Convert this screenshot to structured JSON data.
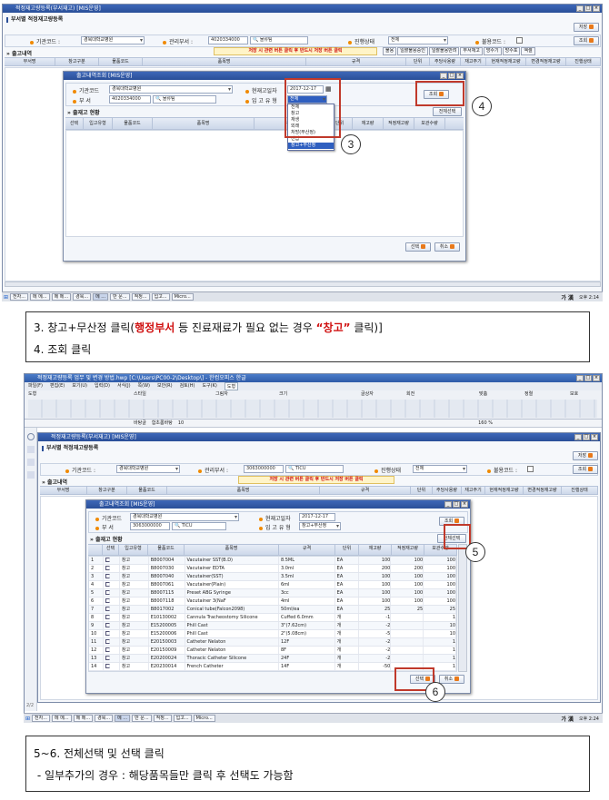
{
  "panel1": {
    "app_title": "적정재고량등록(부서재고) [MIS운영]",
    "page_title": "부서별 적정재고량등록",
    "save_btn": "저장",
    "org_label": "기관코드 :",
    "org_value": "경북대학교병원",
    "dept_label": "관리부서 :",
    "dept_code": "4020334000",
    "dept_name": "물류팀",
    "status_label": "진행상태",
    "status_value": "전체",
    "hold_label": "불용코드 :",
    "search_btn": "조회",
    "section_title": "출고내역",
    "warning_text": "저장 시 관련 버튼 클릭 후 반드시 저장 버튼 클릭",
    "action_buttons": [
      "불용",
      "일괄불용승인",
      "일괄불용반려",
      "부서재고",
      "방수기",
      "방수포",
      "엑셀"
    ],
    "grid_headers": [
      "부서명",
      "창고구분",
      "물품코드",
      "품목명",
      "규격",
      "단위",
      "주당사용량",
      "재고주기",
      "현재적정재고량",
      "변경적정재고량",
      "진행상태"
    ],
    "dialog": {
      "title": "출고내역조회 [MIS운영]",
      "org_label": "기관코드",
      "org_value": "경북대학교병원",
      "dept_label": "부   서",
      "dept_code": "4020334000",
      "dept_name": "물류팀",
      "date_label": "현재고일자",
      "date_value": "2017-12-17",
      "type_label": "입 고 유 형",
      "type_value": "전체",
      "search_btn": "조회",
      "section_title": "출재고 현황",
      "select_all": "전체선택",
      "headers": [
        "선택",
        "입고유형",
        "물품코드",
        "품목명",
        "규격",
        "단위",
        "재고량",
        "적정재고량",
        "보관수량"
      ],
      "dropdown": [
        "전체",
        "창고",
        "재생",
        "외래",
        "처방(무산정)",
        "선납",
        "창고+무산정"
      ],
      "select_btn": "선택",
      "cancel_btn": "취소"
    },
    "taskbar": [
      "전자...",
      "메 메...",
      "메 메...",
      "경북...",
      "메 ...",
      "반 문...",
      "적정...",
      "입고...",
      "Micro..."
    ],
    "tray_text": "가 漢",
    "clock": "오후 2:14",
    "marker3": "3",
    "marker4": "4"
  },
  "caption1": {
    "line1_pre": "3. 창고+무산정 클릭(",
    "line1_red": "행정부서",
    "line1_mid": " 등 진료재료가 필요 없는 경우 ",
    "line1_quote": "“창고”",
    "line1_post": " 클릭)]",
    "line2": "4. 조회 클릭"
  },
  "panel2": {
    "doc_title": "적정재고량등록 업무 및 변경 방법.hwp [C:\\Users\\PC00-2\\Desktop\\] - 한컴오피스 한글",
    "menus": [
      "파일(F)",
      "편집(E)",
      "보기(U)",
      "입력(D)",
      "서식(J)",
      "쪽(W)",
      "보안(R)",
      "검토(H)",
      "도구(K)",
      "도형"
    ],
    "ribbon_groups": [
      "도형",
      "스타일",
      "그림자",
      "크기",
      "글상자",
      "회전",
      "맞춤",
      "정렬",
      "보호"
    ],
    "toolbar_style": "바탕글",
    "toolbar_font": "함초롬바탕",
    "toolbar_size": "10",
    "zoom": "160 %",
    "app_title": "적정재고량등록(부서재고) [MIS운영]",
    "page_title": "부서별 적정재고량등록",
    "save_btn": "저장",
    "org_value": "경북대학교병원",
    "dept_code": "3063000000",
    "dept_name": "TICU",
    "status_value": "전체",
    "search_btn": "조회",
    "dialog": {
      "title": "출고내역조회 [MIS운영]",
      "org_value": "경북대학교병원",
      "dept_code": "3063000000",
      "dept_name": "TICU",
      "date_value": "2017-12-17",
      "type_value": "창고+무산정",
      "section_title": "출재고 현황",
      "select_all": "전체선택",
      "rows": [
        [
          "1",
          "창고",
          "B8007004",
          "Vacutainer SST(B.D)",
          "8.5ML",
          "EA",
          "100",
          "100",
          "100"
        ],
        [
          "2",
          "창고",
          "B8007030",
          "Vacutainer EDTA",
          "3.0ml",
          "EA",
          "200",
          "200",
          "100"
        ],
        [
          "3",
          "창고",
          "B8007040",
          "Vacutainer(SST)",
          "3.5ml",
          "EA",
          "100",
          "100",
          "100"
        ],
        [
          "4",
          "창고",
          "B8007061",
          "Vacutainer(Plain)",
          "6ml",
          "EA",
          "100",
          "100",
          "100"
        ],
        [
          "5",
          "창고",
          "B8007115",
          "Preset ABG Syringe",
          "3cc",
          "EA",
          "100",
          "100",
          "100"
        ],
        [
          "6",
          "창고",
          "B8007118",
          "Vacutainer 3(NaF",
          "4ml",
          "EA",
          "100",
          "100",
          "100"
        ],
        [
          "7",
          "창고",
          "B8017002",
          "Conical tube(Falcon2098)",
          "50ml/ea",
          "EA",
          "25",
          "25",
          "25"
        ],
        [
          "8",
          "창고",
          "E10130002",
          "Cannula Tracheostomy Silicone",
          "Cuffed 6.0mm",
          "개",
          "-1",
          "",
          "1"
        ],
        [
          "9",
          "창고",
          "E15200005",
          "Phill Cast",
          "3\"(7.62cm)",
          "개",
          "-2",
          "",
          "10"
        ],
        [
          "10",
          "창고",
          "E15200006",
          "Phill Cast",
          "2\"(5.08cm)",
          "개",
          "-5",
          "",
          "10"
        ],
        [
          "11",
          "창고",
          "E20150003",
          "Catheter Nelaton",
          "12F",
          "개",
          "-2",
          "",
          "1"
        ],
        [
          "12",
          "창고",
          "E20150009",
          "Catheter Nelaton",
          "8F",
          "개",
          "-2",
          "",
          "1"
        ],
        [
          "13",
          "창고",
          "E20200024",
          "Thoracic Catheter Silicone",
          "24F",
          "개",
          "-2",
          "",
          "1"
        ],
        [
          "14",
          "창고",
          "E20230014",
          "French Catheter",
          "14F",
          "개",
          "-50",
          "",
          "1"
        ]
      ],
      "select_btn": "선택",
      "cancel_btn": "취소"
    },
    "page_indicator": "2/2",
    "taskbar": [
      "전자...",
      "메 메...",
      "메 메...",
      "경북...",
      "메 ...",
      "반 문...",
      "적정...",
      "입고...",
      "Micro..."
    ],
    "tray_text": "가 漢",
    "clock": "오후 2:24",
    "marker5": "5",
    "marker6": "6"
  },
  "caption2": {
    "line1": "5~6. 전체선택 및 선택 클릭",
    "line2": " - 일부추가의 경우 : 해당품목들만 클릭 후 선택도 가능함"
  }
}
